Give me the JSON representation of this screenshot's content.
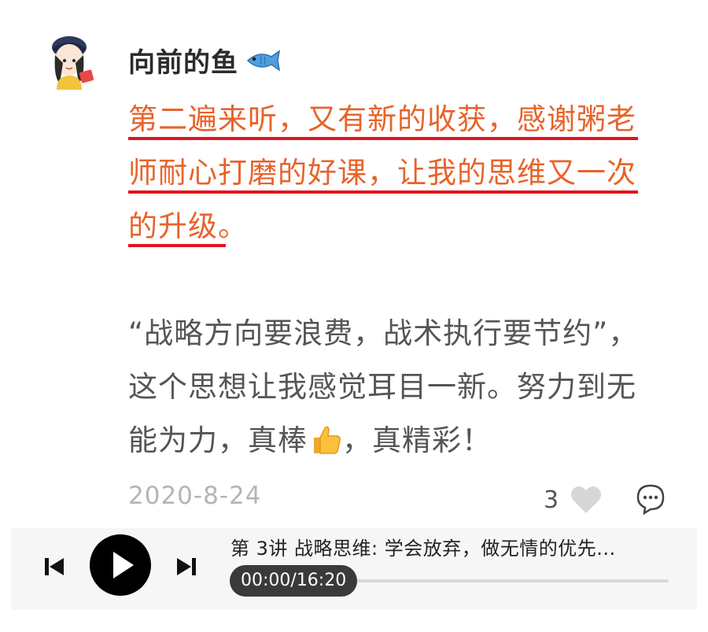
{
  "comment": {
    "username": "向前的鱼",
    "highlighted_lines": [
      "第二遍来听，又有新的收获，感谢粥老",
      "师耐心打磨的好课，让我的思维又一次",
      "的升级。"
    ],
    "body_line1": "“战略方向要浪费，战术执行要节约”，",
    "body_line2": "这个思想让我感觉耳目一新。努力到无",
    "body_line3_before": "能为力，真棒",
    "body_line3_after": "，真精彩！",
    "date": "2020-8-24",
    "like_count": "3"
  },
  "player": {
    "track_title": "第 3讲 战略思维: 学会放弃，做无情的优先...",
    "time_display": "00:00/16:20",
    "progress": 0
  },
  "colors": {
    "highlight_text": "#e8632a",
    "underline": "#e0141e",
    "body_text": "#555555"
  }
}
